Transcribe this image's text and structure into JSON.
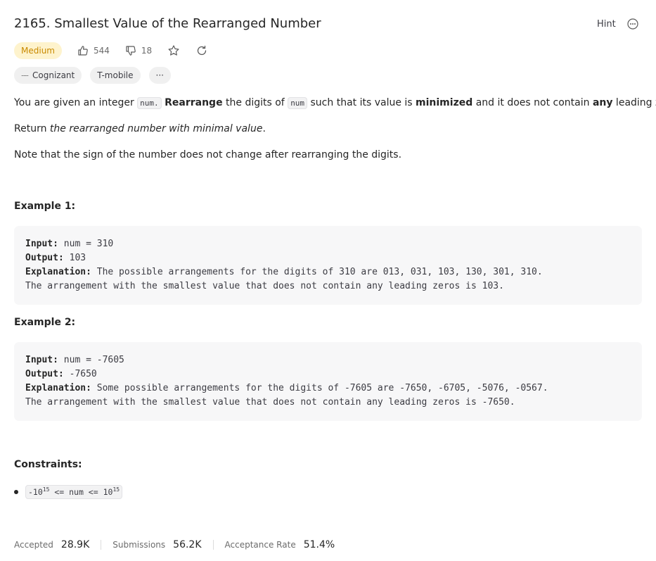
{
  "problem": {
    "title": "2165. Smallest Value of the Rearranged Number",
    "difficulty": "Medium",
    "likes": "544",
    "dislikes": "18",
    "hint_label": "Hint"
  },
  "tags": [
    "Cognizant",
    "T-mobile"
  ],
  "tags_more": "···",
  "description": {
    "p1": {
      "t1": "You are given an integer ",
      "c1": "num.",
      "t2": " ",
      "b1": "Rearrange",
      "t3": " the digits of ",
      "c2": "num",
      "t4": " such that its value is ",
      "b2": "minimized",
      "t5": " and it does not contain ",
      "b3": "any",
      "t6": " leading zeros."
    },
    "p2": {
      "t1": "Return ",
      "i1": "the rearranged number with minimal value",
      "t2": "."
    },
    "p3": "Note that the sign of the number does not change after rearranging the digits."
  },
  "examples": [
    {
      "title": "Example 1:",
      "input_label": "Input:",
      "input": " num = 310",
      "output_label": "Output:",
      "output": " 103",
      "explanation_label": "Explanation:",
      "explanation": " The possible arrangements for the digits of 310 are 013, 031, 103, 130, 301, 310.",
      "explanation_2": "The arrangement with the smallest value that does not contain any leading zeros is 103."
    },
    {
      "title": "Example 2:",
      "input_label": "Input:",
      "input": " num = -7605",
      "output_label": "Output:",
      "output": " -7650",
      "explanation_label": "Explanation:",
      "explanation": " Some possible arrangements for the digits of -7605 are -7650, -6705, -5076, -0567.",
      "explanation_2": "The arrangement with the smallest value that does not contain any leading zeros is -7650."
    }
  ],
  "constraints": {
    "title": "Constraints:",
    "items": [
      {
        "a": "-10",
        "a_exp": "15",
        "b": " <= num <= 10",
        "b_exp": "15"
      }
    ]
  },
  "stats": {
    "accepted_label": "Accepted",
    "accepted": "28.9K",
    "submissions_label": "Submissions",
    "submissions": "56.2K",
    "rate_label": "Acceptance Rate",
    "rate": "51.4%"
  },
  "colors": {
    "difficulty_medium": "#c98a00",
    "difficulty_bg": "#fef3cd",
    "code_bg": "#f7f7f8"
  },
  "icons": [
    "thumbs-up-icon",
    "thumbs-down-icon",
    "star-icon",
    "refresh-icon",
    "more-icon"
  ]
}
